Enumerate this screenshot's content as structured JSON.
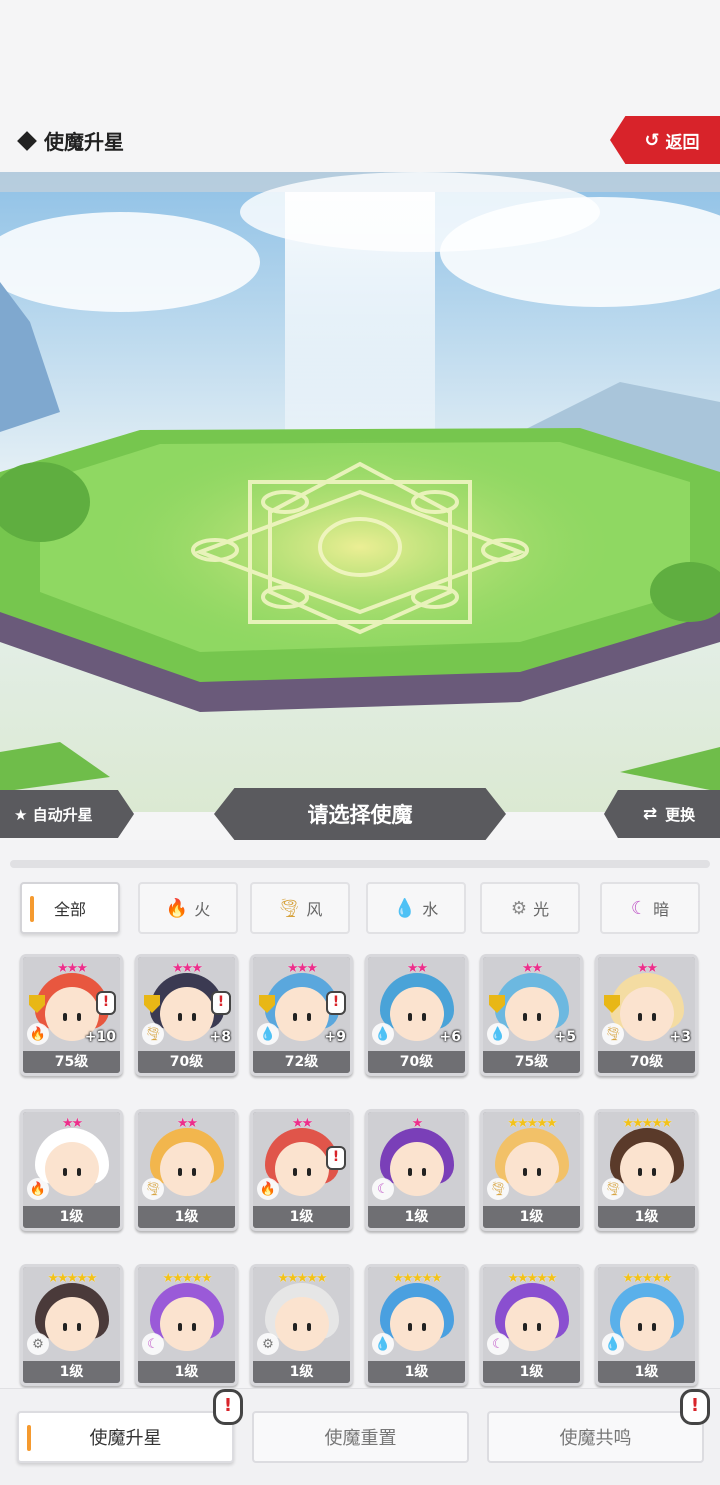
{
  "header": {
    "title": "使魔升星",
    "back_label": "返回"
  },
  "action_bar": {
    "auto_label": "★ 自动升星",
    "select_label": "请选择使魔",
    "switch_label": "更换"
  },
  "tabs": [
    {
      "label": "全部",
      "icon": "",
      "active": true
    },
    {
      "label": "火",
      "icon": "fire-icon"
    },
    {
      "label": "风",
      "icon": "wind-icon"
    },
    {
      "label": "水",
      "icon": "water-icon"
    },
    {
      "label": "光",
      "icon": "light-icon"
    },
    {
      "label": "暗",
      "icon": "dark-icon"
    }
  ],
  "cards": [
    {
      "stars": "★★★",
      "star_color": "pink",
      "level": "75级",
      "plus": "+10",
      "element": "fire",
      "shield": true,
      "alert": true,
      "hair": "#e8573f"
    },
    {
      "stars": "★★★",
      "star_color": "pink",
      "level": "70级",
      "plus": "+8",
      "element": "wind",
      "shield": true,
      "alert": true,
      "hair": "#3b3a52"
    },
    {
      "stars": "★★★",
      "star_color": "pink",
      "level": "72级",
      "plus": "+9",
      "element": "water",
      "shield": true,
      "alert": true,
      "hair": "#5aa7dd"
    },
    {
      "stars": "★★",
      "star_color": "pink",
      "level": "70级",
      "plus": "+6",
      "element": "water",
      "shield": false,
      "alert": false,
      "hair": "#4aa3d8"
    },
    {
      "stars": "★★",
      "star_color": "pink",
      "level": "75级",
      "plus": "+5",
      "element": "water",
      "shield": true,
      "alert": false,
      "hair": "#6cb8e0"
    },
    {
      "stars": "★★",
      "star_color": "pink",
      "level": "70级",
      "plus": "+3",
      "element": "wind",
      "shield": true,
      "alert": false,
      "hair": "#f4dca2"
    },
    {
      "stars": "★★",
      "star_color": "pink",
      "level": "1级",
      "plus": "",
      "element": "fire",
      "shield": false,
      "alert": false,
      "hair": "#ffffff"
    },
    {
      "stars": "★★",
      "star_color": "pink",
      "level": "1级",
      "plus": "",
      "element": "wind",
      "shield": false,
      "alert": false,
      "hair": "#f2b64d"
    },
    {
      "stars": "★★",
      "star_color": "pink",
      "level": "1级",
      "plus": "",
      "element": "fire",
      "shield": false,
      "alert": true,
      "hair": "#e0554a"
    },
    {
      "stars": "★",
      "star_color": "pink",
      "level": "1级",
      "plus": "",
      "element": "dark",
      "shield": false,
      "alert": false,
      "hair": "#7a3fb8"
    },
    {
      "stars": "★★★★★",
      "star_color": "gold",
      "level": "1级",
      "plus": "",
      "element": "wind",
      "shield": false,
      "alert": false,
      "hair": "#f2c168"
    },
    {
      "stars": "★★★★★",
      "star_color": "gold",
      "level": "1级",
      "plus": "",
      "element": "wind",
      "shield": false,
      "alert": false,
      "hair": "#5a3a2a"
    },
    {
      "stars": "★★★★★",
      "star_color": "gold",
      "level": "1级",
      "plus": "",
      "element": "light",
      "shield": false,
      "alert": false,
      "hair": "#4a3a3a"
    },
    {
      "stars": "★★★★★",
      "star_color": "gold",
      "level": "1级",
      "plus": "",
      "element": "dark",
      "shield": false,
      "alert": false,
      "hair": "#9a5ad8"
    },
    {
      "stars": "★★★★★",
      "star_color": "gold",
      "level": "1级",
      "plus": "",
      "element": "light",
      "shield": false,
      "alert": false,
      "hair": "#e6e6e6"
    },
    {
      "stars": "★★★★★",
      "star_color": "gold",
      "level": "1级",
      "plus": "",
      "element": "water",
      "shield": false,
      "alert": false,
      "hair": "#4aa0e0"
    },
    {
      "stars": "★★★★★",
      "star_color": "gold",
      "level": "1级",
      "plus": "",
      "element": "dark",
      "shield": false,
      "alert": false,
      "hair": "#8a4fd0"
    },
    {
      "stars": "★★★★★",
      "star_color": "gold",
      "level": "1级",
      "plus": "",
      "element": "water",
      "shield": false,
      "alert": false,
      "hair": "#5ab0ea"
    }
  ],
  "bottom_nav": [
    {
      "label": "使魔升星",
      "active": true
    },
    {
      "label": "使魔重置",
      "active": false
    },
    {
      "label": "使魔共鸣",
      "active": false
    }
  ],
  "alert_mark": "!",
  "colors": {
    "accent": "#f59a2f",
    "back_red": "#d8232a",
    "dark_bar": "#5a5a5e"
  }
}
